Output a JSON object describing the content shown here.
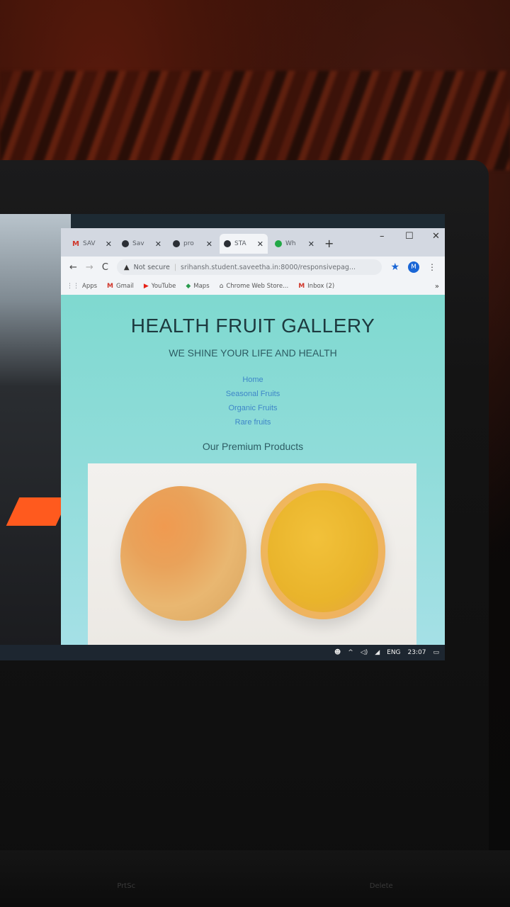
{
  "browser": {
    "tabs": [
      {
        "label": "SAV",
        "icon": "gmail-icon",
        "active": false
      },
      {
        "label": "Sav",
        "icon": "globe-icon",
        "active": false
      },
      {
        "label": "pro",
        "icon": "globe-icon",
        "active": false
      },
      {
        "label": "STA",
        "icon": "globe-icon",
        "active": true
      },
      {
        "label": "Wh",
        "icon": "whatsapp-icon",
        "active": false
      }
    ],
    "new_tab": "+",
    "window_controls": {
      "minimize": "–",
      "maximize": "☐",
      "close": "✕"
    },
    "security_label": "Not secure",
    "url": "srihansh.student.saveetha.in:8000/responsivepag...",
    "avatar_letter": "M",
    "bookmarks": [
      {
        "label": "Apps",
        "icon": "apps-grid-icon"
      },
      {
        "label": "Gmail",
        "icon": "gmail-icon"
      },
      {
        "label": "YouTube",
        "icon": "youtube-icon"
      },
      {
        "label": "Maps",
        "icon": "maps-icon"
      },
      {
        "label": "Chrome Web Store...",
        "icon": "webstore-icon"
      },
      {
        "label": "Inbox (2)",
        "icon": "gmail-icon"
      }
    ],
    "bookmarks_more": "»"
  },
  "page": {
    "title": "HEALTH FRUIT GALLERY",
    "subtitle": "WE SHINE YOUR LIFE AND HEALTH",
    "nav": [
      "Home",
      "Seasonal Fruits",
      "Organic Fruits",
      "Rare fruits"
    ],
    "products_heading": "Our Premium Products"
  },
  "taskbar": {
    "language": "ENG",
    "time": "23:07"
  },
  "keyboard": {
    "visible_keys": [
      "PrtSc",
      "Delete"
    ]
  },
  "colors": {
    "page_bg": "#8fdcd9",
    "title": "#1d3a3f",
    "nav_link": "#3e86c8",
    "accent_blue": "#1a66d6"
  }
}
